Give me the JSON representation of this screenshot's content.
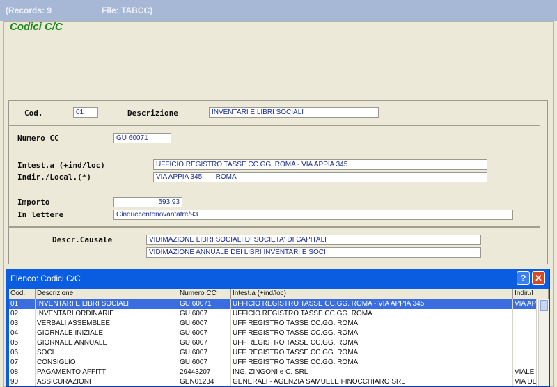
{
  "titlebar": {
    "records": "(Records: 9",
    "file": "File: TABCC)"
  },
  "app_title": "Codici C/C",
  "form": {
    "cod_label": "Cod.",
    "cod_value": "01",
    "descr_label": "Descrizione",
    "descr_value": "INVENTARI E LIBRI SOCIALI",
    "numero_label": "Numero CC",
    "numero_value": "GU 60071",
    "intesta_label": "Intest.a (+ind/loc)",
    "intesta_value": "UFFICIO REGISTRO TASSE CC.GG. ROMA - VIA APPIA 345",
    "indir_label": "Indir./Local.(*)",
    "indir_value": "VIA APPIA 345       ROMA",
    "importo_label": "Importo",
    "importo_value": "593,93",
    "lettere_label": "In lettere",
    "lettere_value": "Cinquecentonovantatre/93",
    "causale_label": "Descr.Causale",
    "causale_line1": "VIDIMAZIONE LIBRI SOCIALI DI SOCIETA' DI CAPITALI",
    "causale_line2": "VIDIMAZIONE ANNUALE DEI LIBRI INVENTARI E SOCI"
  },
  "list": {
    "title": "Elenco: Codici C/C",
    "help_glyph": "?",
    "close_glyph": "✕",
    "columns": [
      "Cod.",
      "Descrizione",
      "Numero CC",
      "Intest.a (+ind/loc)",
      "Indir./l"
    ],
    "rows": [
      [
        "01",
        "INVENTARI E LIBRI SOCIALI",
        "GU 60071",
        "UFFICIO REGISTRO TASSE CC.GG. ROMA - VIA APPIA 345",
        "VIA AP"
      ],
      [
        "02",
        "INVENTARI ORDINARIE",
        "GU 6007",
        "UFFICIO REGISTRO TASSE CC.GG. ROMA",
        ""
      ],
      [
        "03",
        "VERBALI ASSEMBLEE",
        "GU 6007",
        "UFF REGISTRO TASSE CC.GG. ROMA",
        ""
      ],
      [
        "04",
        "GIORNALE INIZIALE",
        "GU 6007",
        "UFF REGISTRO TASSE CC.GG. ROMA",
        ""
      ],
      [
        "05",
        "GIORNALE ANNUALE",
        "GU 6007",
        "UFF REGISTRO TASSE CC.GG. ROMA",
        ""
      ],
      [
        "06",
        "SOCI",
        "GU 6007",
        "UFF REGISTRO TASSE CC.GG. ROMA",
        ""
      ],
      [
        "07",
        "CONSIGLIO",
        "GU 6007",
        "UFF REGISTRO TASSE CC.GG. ROMA",
        ""
      ],
      [
        "08",
        "PAGAMENTO AFFITTI",
        "29443207",
        "ING. ZINGONI e C. SRL",
        "VIALE"
      ],
      [
        "90",
        "ASSICURAZIONI",
        "GEN01234",
        "GENERALI - AGENZIA SAMUELE FINOCCHIARO SRL",
        "VIA DE"
      ]
    ],
    "selected_row": 0
  }
}
